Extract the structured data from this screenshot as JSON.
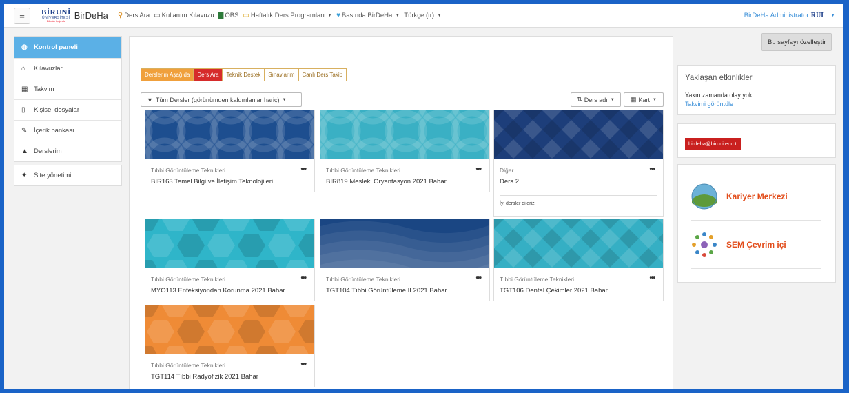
{
  "navbar": {
    "brand_line1": "BİRUNİ",
    "brand_line2": "ÜNİVERSİTESİ",
    "brand_line3": "Bilimin Işığında",
    "brand_name": "BirDeHa",
    "links": [
      {
        "label": "Ders Ara",
        "icon": "search-icon",
        "caret": false
      },
      {
        "label": "Kullanım Kılavuzu",
        "icon": "book-icon",
        "caret": false
      },
      {
        "label": "OBS",
        "icon": "document-icon",
        "caret": false
      },
      {
        "label": "Haftalık Ders Programları",
        "icon": "folder-icon",
        "caret": true
      },
      {
        "label": "Basında BirDeHa",
        "icon": "heart-icon",
        "caret": true
      },
      {
        "label": "Türkçe (tr)",
        "icon": "",
        "caret": true
      }
    ],
    "user_name": "BirDeHa Administrator",
    "user_logo": "RUI"
  },
  "sidebar": {
    "group1": [
      {
        "label": "Kontrol paneli",
        "icon": "dashboard-icon"
      },
      {
        "label": "Kılavuzlar",
        "icon": "home-icon"
      },
      {
        "label": "Takvim",
        "icon": "calendar-icon"
      },
      {
        "label": "Kişisel dosyalar",
        "icon": "file-icon"
      },
      {
        "label": "İçerik bankası",
        "icon": "paint-brush-icon"
      },
      {
        "label": "Derslerim",
        "icon": "graduation-cap-icon"
      }
    ],
    "group2": [
      {
        "label": "Site yönetimi",
        "icon": "wrench-icon"
      }
    ]
  },
  "customize_button": "Bu sayfayı özelleştir",
  "tabs": [
    "Derslerim Aşağıda",
    "Ders Ara",
    "Teknik Destek",
    "Sınavlarım",
    "Canlı Ders Takip"
  ],
  "filter": {
    "label": "Tüm Dersler (görünümden kaldırılanlar hariç)"
  },
  "sort": {
    "label": "Ders adı"
  },
  "view": {
    "label": "Kart"
  },
  "courses": [
    {
      "category": "Tıbbi Görüntüleme Teknikleri",
      "name": "BIR163 Temel Bilgi ve İletişim Teknolojileri ...",
      "pattern": "circles-dark",
      "color": "#1d4e8f"
    },
    {
      "category": "Tıbbi Görüntüleme Teknikleri",
      "name": "BIR819 Mesleki Oryantasyon 2021 Bahar",
      "pattern": "circles-teal",
      "color": "#3ab0c4"
    },
    {
      "category": "Diğer",
      "name": "Ders 2",
      "summary": "İyi dersler dileriz.",
      "pattern": "diamonds-dark",
      "color": "#1d3e7a"
    },
    {
      "category": "Tıbbi Görüntüleme Teknikleri",
      "name": "MYO113 Enfeksiyondan Korunma 2021 Bahar",
      "pattern": "hexagons-teal",
      "color": "#2fb5c9"
    },
    {
      "category": "Tıbbi Görüntüleme Teknikleri",
      "name": "TGT104 Tıbbi Görüntüleme II 2021 Bahar",
      "pattern": "waves-dark",
      "color": "#1a4683"
    },
    {
      "category": "Tıbbi Görüntüleme Teknikleri",
      "name": "TGT106 Dental Çekimler 2021 Bahar",
      "pattern": "diamonds-teal",
      "color": "#35afc4"
    },
    {
      "category": "Tıbbi Görüntüleme Teknikleri",
      "name": "TGT114 Tıbbi Radyofizik 2021 Bahar",
      "pattern": "hexagons-orange",
      "color": "#ef8b36"
    }
  ],
  "events": {
    "title": "Yaklaşan etkinlikler",
    "empty": "Yakın zamanda olay yok",
    "link": "Takvimi görüntüle"
  },
  "contact": {
    "email": "birdeha@biruni.edu.tr"
  },
  "promos": [
    {
      "label": "Kariyer Merkezi",
      "icon": "globe-icon"
    },
    {
      "label": "SEM Çevrim içi",
      "icon": "people-circle-icon"
    }
  ]
}
